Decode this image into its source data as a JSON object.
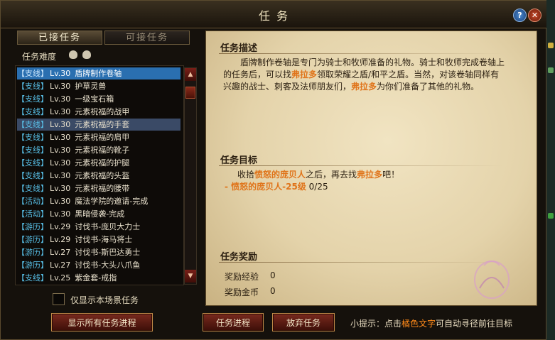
{
  "window": {
    "title": "任    务",
    "help_label": "?",
    "close_label": "✕"
  },
  "tabs": {
    "accepted": "已接任务",
    "available": "可接任务"
  },
  "difficulty_label": "任务难度",
  "quest_list": [
    {
      "cat": "【支线】",
      "lvl": "Lv.30",
      "name": "盾牌制作卷轴"
    },
    {
      "cat": "【支线】",
      "lvl": "Lv.30",
      "name": "护草灵兽"
    },
    {
      "cat": "【支线】",
      "lvl": "Lv.30",
      "name": "一级宝石箱"
    },
    {
      "cat": "【支线】",
      "lvl": "Lv.30",
      "name": "元素祝福的战甲"
    },
    {
      "cat": "【支线】",
      "lvl": "Lv.30",
      "name": "元素祝福的手套"
    },
    {
      "cat": "【支线】",
      "lvl": "Lv.30",
      "name": "元素祝福的肩甲"
    },
    {
      "cat": "【支线】",
      "lvl": "Lv.30",
      "name": "元素祝福的靴子"
    },
    {
      "cat": "【支线】",
      "lvl": "Lv.30",
      "name": "元素祝福的护腿"
    },
    {
      "cat": "【支线】",
      "lvl": "Lv.30",
      "name": "元素祝福的头盔"
    },
    {
      "cat": "【支线】",
      "lvl": "Lv.30",
      "name": "元素祝福的腰带"
    },
    {
      "cat": "【活动】",
      "lvl": "Lv.30",
      "name": "魔法学院的邀请-完成"
    },
    {
      "cat": "【活动】",
      "lvl": "Lv.30",
      "name": "黑暗侵袭-完成"
    },
    {
      "cat": "【游历】",
      "lvl": "Lv.29",
      "name": "讨伐书-庞贝大力士"
    },
    {
      "cat": "【游历】",
      "lvl": "Lv.29",
      "name": "讨伐书-海马将士"
    },
    {
      "cat": "【游历】",
      "lvl": "Lv.27",
      "name": "讨伐书-斯巴达勇士"
    },
    {
      "cat": "【游历】",
      "lvl": "Lv.27",
      "name": "讨伐书-大头八爪鱼"
    },
    {
      "cat": "【支线】",
      "lvl": "Lv.25",
      "name": "紫金套-戒指"
    }
  ],
  "scroll": {
    "up": "▲",
    "down": "▼"
  },
  "filter_checkbox_label": "仅显示本场景任务",
  "buttons": {
    "show_all": "显示所有任务进程",
    "progress": "任务进程",
    "abandon": "放弃任务"
  },
  "detail": {
    "desc_title": "任务描述",
    "desc": {
      "p1": "盾牌制作卷轴是专门为骑士和牧师准备的礼物。骑士和牧师完成卷轴上的任务后，可以找",
      "npc1": "弗拉多",
      "p2": "领取荣耀之盾/和平之盾。当然，对该卷轴同样有兴趣的战士、刺客及法师朋友们，",
      "npc2": "弗拉多",
      "p3": "为你们准备了其他的礼物。"
    },
    "goal_title": "任务目标",
    "goal": {
      "t1": "收拾",
      "mob": "愤怒的庞贝人",
      "t2": "之后，再去找",
      "npc": "弗拉多",
      "t3": "吧！"
    },
    "progress": {
      "dash": "- ",
      "mob": "愤怒的庞贝人-25级",
      "count": " 0/25"
    },
    "reward_title": "任务奖励",
    "rewards": {
      "exp_label": "奖励经验",
      "exp_value": "0",
      "gold_label": "奖励金币",
      "gold_value": "0"
    }
  },
  "hint": {
    "prefix": "小提示：点击",
    "orange": "橘色文字",
    "suffix": "可自动寻径前往目标"
  },
  "colors": {
    "accent_orange": "#e0741a",
    "selected_row": "#2a6fb0"
  }
}
